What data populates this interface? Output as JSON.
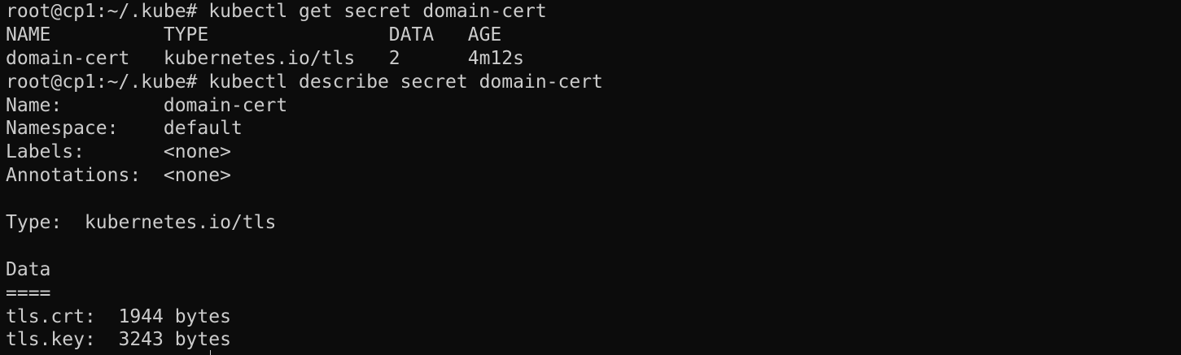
{
  "colors": {
    "background": "#0c0c0c",
    "foreground": "#cccccc"
  },
  "terminal": {
    "lines": [
      "root@cp1:~/.kube# kubectl get secret domain-cert",
      "NAME          TYPE                DATA   AGE",
      "domain-cert   kubernetes.io/tls   2      4m12s",
      "root@cp1:~/.kube# kubectl describe secret domain-cert",
      "Name:         domain-cert",
      "Namespace:    default",
      "Labels:       <none>",
      "Annotations:  <none>",
      "",
      "Type:  kubernetes.io/tls",
      "",
      "Data",
      "====",
      "tls.crt:  1944 bytes",
      "tls.key:  3243 bytes"
    ]
  }
}
